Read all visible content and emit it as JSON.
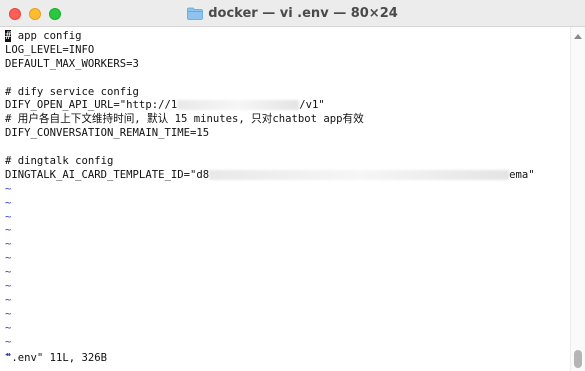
{
  "window": {
    "title": "docker — vi .env — 80×24",
    "folder_icon": "folder-icon"
  },
  "file": {
    "lines": [
      {
        "text": "# app config",
        "cursor": true
      },
      {
        "text": "LOG_LEVEL=INFO"
      },
      {
        "text": "DEFAULT_MAX_WORKERS=3"
      },
      {
        "text": ""
      },
      {
        "text": "# dify service config"
      },
      {
        "text": "DIFY_OPEN_API_URL=\"http://1",
        "redacted_tail": "/v1\""
      },
      {
        "text": "# 用户各自上下文维持时间, 默认 15 minutes, 只对chatbot app有效"
      },
      {
        "text": "DIFY_CONVERSATION_REMAIN_TIME=15"
      },
      {
        "text": ""
      },
      {
        "text": "# dingtalk config"
      },
      {
        "text": "DINGTALK_AI_CARD_TEMPLATE_ID=\"d8",
        "redacted_tail": "ema\""
      }
    ],
    "tilde_count": 13,
    "tilde_char": "~"
  },
  "status": {
    "message": "\".env\" 11L, 326B"
  },
  "colors": {
    "tilde": "#3b49c4",
    "titlebar": "#ececec",
    "close": "#ff5f57",
    "minimize": "#febc2e",
    "maximize": "#28c840"
  }
}
